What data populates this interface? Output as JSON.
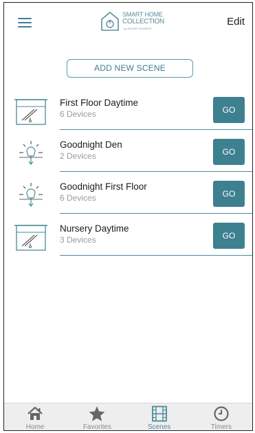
{
  "header": {
    "brand_line1": "SMART HOME",
    "brand_line2": "COLLECTION",
    "brand_line3": "by BUDGET BLINDS®",
    "edit_label": "Edit"
  },
  "add_scene_label": "ADD NEW SCENE",
  "scenes": [
    {
      "name": "First Floor Daytime",
      "devices": "6 Devices",
      "icon": "window-shade-icon",
      "go": "GO"
    },
    {
      "name": "Goodnight Den",
      "devices": "2 Devices",
      "icon": "lamp-icon",
      "go": "GO"
    },
    {
      "name": "Goodnight First Floor",
      "devices": "6 Devices",
      "icon": "lamp-icon",
      "go": "GO"
    },
    {
      "name": "Nursery Daytime",
      "devices": "3 Devices",
      "icon": "window-shade-icon",
      "go": "GO"
    }
  ],
  "tabs": [
    {
      "label": "Home",
      "icon": "home-icon",
      "active": false
    },
    {
      "label": "Favorites",
      "icon": "star-icon",
      "active": false
    },
    {
      "label": "Scenes",
      "icon": "film-icon",
      "active": true
    },
    {
      "label": "Timers",
      "icon": "clock-icon",
      "active": false
    }
  ],
  "colors": {
    "accent": "#3d8090",
    "tab_inactive": "#8a8a8a",
    "tab_active": "#4a8a99"
  }
}
